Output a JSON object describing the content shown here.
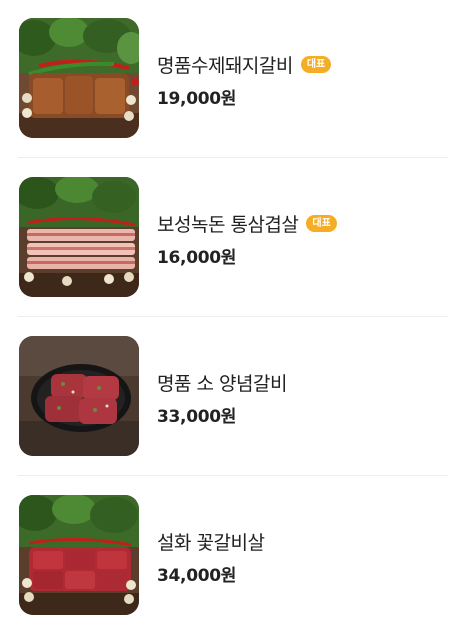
{
  "menu": {
    "items": [
      {
        "name": "명품수제돼지갈비",
        "price": "19,000원",
        "badge": "대표",
        "image": "grilled-pork-ribs-with-greens"
      },
      {
        "name": "보성녹돈 통삼겹살",
        "price": "16,000원",
        "badge": "대표",
        "image": "raw-pork-belly-slices-with-greens"
      },
      {
        "name": "명품 소 양념갈비",
        "price": "33,000원",
        "badge": "",
        "image": "marinated-beef-ribs-on-black-plate"
      },
      {
        "name": "설화 꽃갈비살",
        "price": "34,000원",
        "badge": "",
        "image": "marbled-beef-rib-fingers-with-greens"
      }
    ]
  },
  "colors": {
    "badge_background": "#f6ad26",
    "badge_text": "#ffffff",
    "divider": "#eeeeee",
    "text": "#222222"
  }
}
